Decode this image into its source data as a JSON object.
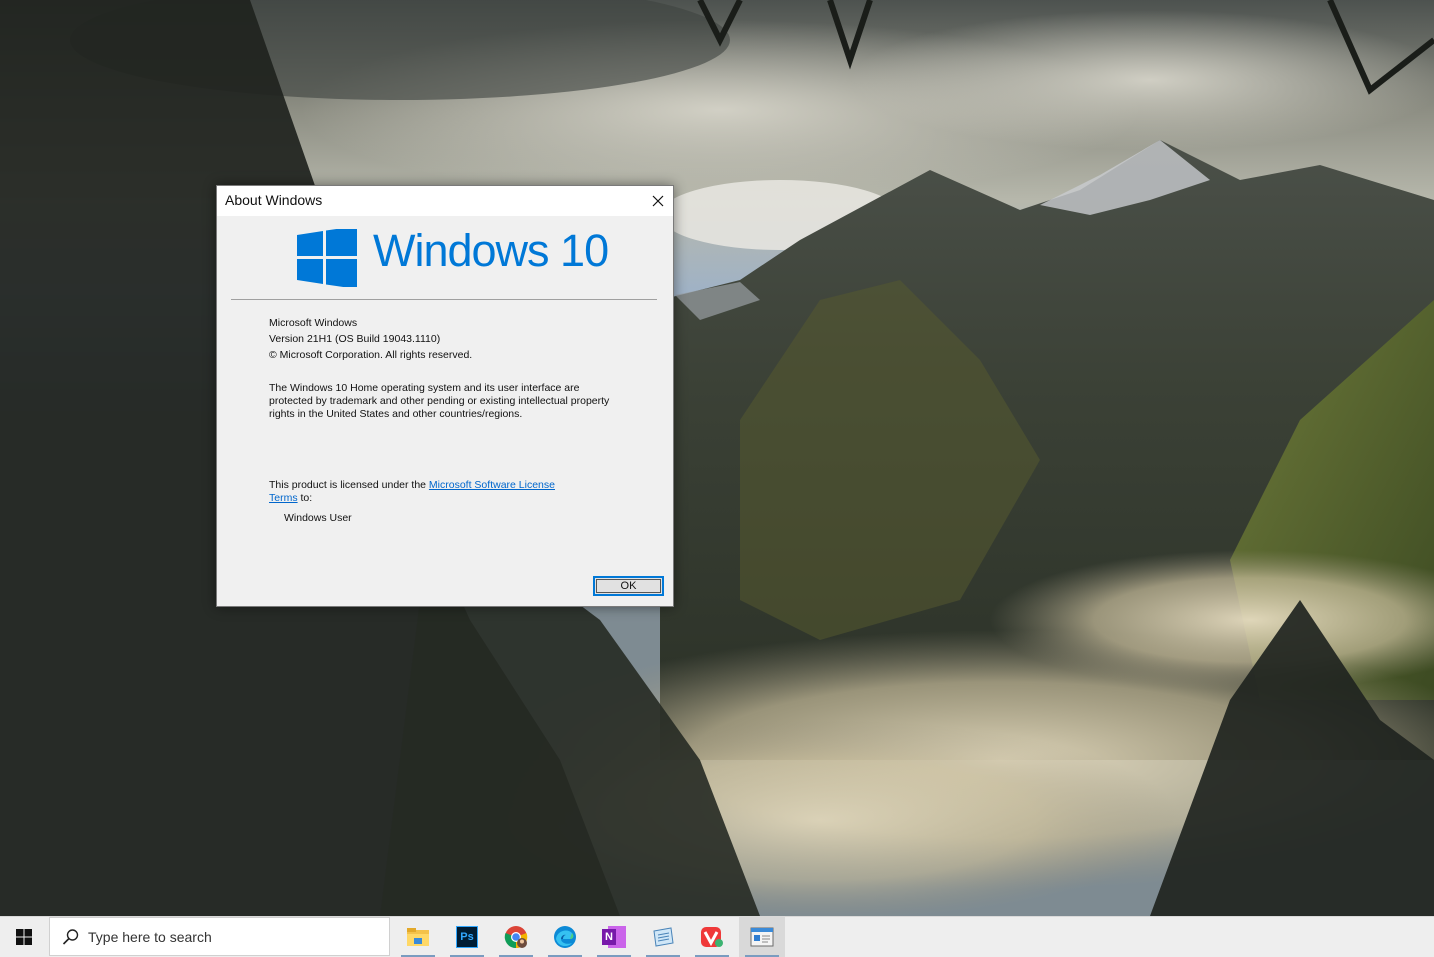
{
  "dialog": {
    "title": "About Windows",
    "logo_text": "Windows 10",
    "product_name": "Microsoft Windows",
    "version": "Version 21H1 (OS Build 19043.1110)",
    "copyright": "© Microsoft Corporation. All rights reserved.",
    "legal_line1": "The Windows 10 Home operating system and its user interface are",
    "legal_line2": "protected by trademark and other pending or existing intellectual property",
    "legal_line3": "rights in the United States and other countries/regions.",
    "license_prefix": "This product is licensed under the ",
    "license_link_part1": "Microsoft Software License",
    "license_link_part2": "Terms",
    "license_suffix": " to:",
    "licensed_user": "Windows User",
    "ok_label": "OK"
  },
  "taskbar": {
    "search_placeholder": "Type here to search",
    "apps": [
      {
        "name": "file-explorer",
        "icon": "folder-icon"
      },
      {
        "name": "photoshop",
        "icon": "photoshop-icon",
        "label": "Ps"
      },
      {
        "name": "chrome",
        "icon": "chrome-icon"
      },
      {
        "name": "edge",
        "icon": "edge-icon"
      },
      {
        "name": "onenote",
        "icon": "onenote-icon",
        "label": "N"
      },
      {
        "name": "notepad",
        "icon": "notepad-icon"
      },
      {
        "name": "vivaldi",
        "icon": "vivaldi-icon"
      },
      {
        "name": "winver",
        "icon": "winver-icon"
      }
    ]
  },
  "colors": {
    "windows_blue": "#0078d7",
    "link": "#0066cc",
    "dialog_bg": "#f0f0f0",
    "taskbar_bg": "#eeeeee"
  }
}
